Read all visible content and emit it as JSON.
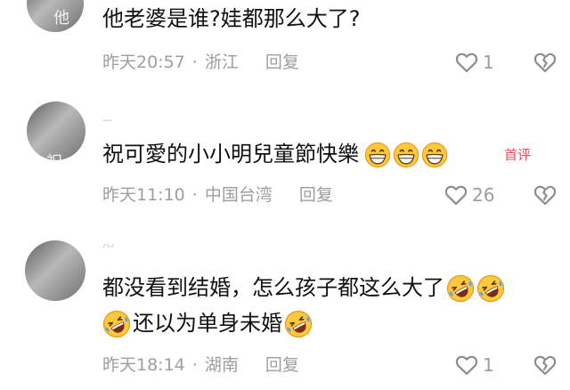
{
  "comments": [
    {
      "avatar_hint": "他",
      "text": "他老婆是谁?娃都那么大了?",
      "time": "昨天20:57",
      "location": "浙江",
      "reply_label": "回复",
      "like_count": "1",
      "like_icon": "heart-outline-icon",
      "dislike_icon": "broken-heart-icon"
    },
    {
      "avatar_hint": "祝",
      "username_hint": "—",
      "text": "祝可愛的小小明兒童節快樂",
      "emojis": [
        "grin-emoji",
        "grin-emoji",
        "grin-emoji"
      ],
      "badge": "首评",
      "time": "昨天11:10",
      "location": "中国台湾",
      "reply_label": "回复",
      "like_count": "26",
      "like_icon": "heart-outline-icon",
      "dislike_icon": "broken-heart-icon"
    },
    {
      "username_hint": "ᐟᐠᐟ",
      "text_line1": "都没看到结婚，怎么孩子都这么大了",
      "text_line2": "还以为单身未婚",
      "emojis": [
        "rofl-emoji",
        "rofl-emoji",
        "rofl-emoji",
        "rofl-emoji"
      ],
      "time": "昨天18:14",
      "location": "湖南",
      "reply_label": "回复",
      "like_count": "1",
      "like_icon": "heart-outline-icon",
      "dislike_icon": "broken-heart-icon"
    }
  ],
  "colors": {
    "meta_gray": "#9e9e9e",
    "badge_red": "#f04a5a",
    "emoji_yellow": "#ffc83d"
  }
}
